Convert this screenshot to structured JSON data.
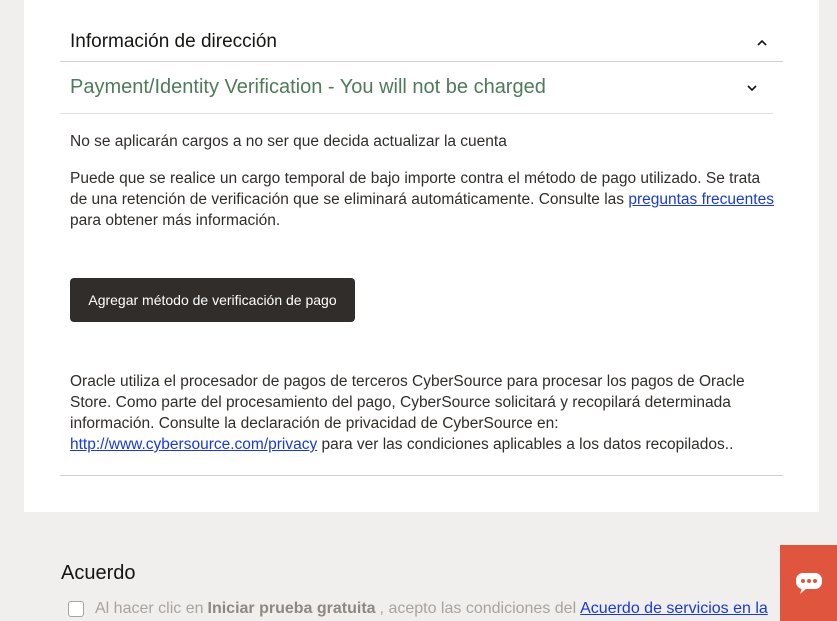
{
  "address_section": {
    "title": "Información de dirección"
  },
  "payment_section": {
    "title": "Payment/Identity Verification - You will not be charged",
    "no_charge_text": "No se aplicarán cargos a no ser que decida actualizar la cuenta",
    "temp_charge_text": "Puede que se realice un cargo temporal de bajo importe contra el método de pago utilizado. Se trata de una retención de verificación que se eliminará automáticamente. Consulte las ",
    "faq_link": "preguntas frecuentes",
    "temp_charge_suffix": " para obtener más información.",
    "add_payment_button": "Agregar método de verificación de pago",
    "processor_text": "Oracle utiliza el procesador de pagos de terceros CyberSource para procesar los pagos de Oracle Store. Como parte del procesamiento del pago, CyberSource solicitará y recopilará determinada información. Consulte la declaración de privacidad de CyberSource en: ",
    "privacy_link": "http://www.cybersource.com/privacy",
    "processor_suffix": " para ver las condiciones aplicables a los datos recopilados.."
  },
  "agreement_section": {
    "title": "Acuerdo",
    "prefix": "Al hacer clic en",
    "bold_term": "Iniciar prueba gratuita",
    "middle": ", acepto las condiciones del",
    "link": "Acuerdo de servicios en la"
  },
  "icons": {
    "chevron_up": "chevron-up-icon",
    "chevron_down": "chevron-down-icon",
    "chat": "chat-icon"
  },
  "colors": {
    "accent_green": "#4f7b5a",
    "button_dark": "#312d2a",
    "link_blue": "#1a3ad6",
    "chat_orange": "#e0553e"
  }
}
